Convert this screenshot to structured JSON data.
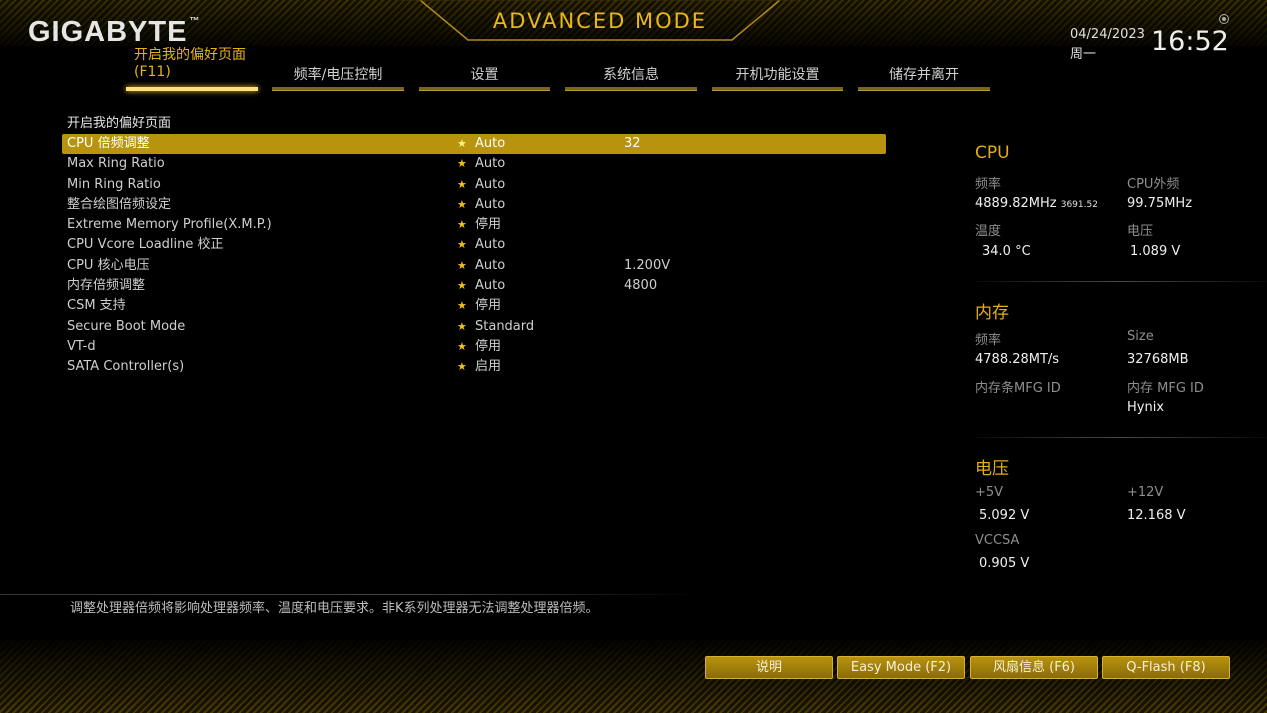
{
  "header": {
    "brand": "GIGABYTE",
    "trademark": "™",
    "mode_title": "ADVANCED MODE",
    "date": "04/24/2023",
    "weekday": "周一",
    "time": "16:52"
  },
  "tabs": [
    {
      "label": "开启我的偏好页面",
      "shortcut": "(F11)",
      "active": true
    },
    {
      "label": "频率/电压控制"
    },
    {
      "label": "设置"
    },
    {
      "label": "系统信息"
    },
    {
      "label": "开机功能设置"
    },
    {
      "label": "储存并离开"
    }
  ],
  "menu": {
    "heading": "开启我的偏好页面",
    "items": [
      {
        "name": "CPU 倍频调整",
        "value": "Auto",
        "value2": "32",
        "selected": true
      },
      {
        "name": "Max Ring Ratio",
        "value": "Auto",
        "value2": ""
      },
      {
        "name": "Min Ring Ratio",
        "value": "Auto",
        "value2": ""
      },
      {
        "name": "整合绘图倍频设定",
        "value": "Auto",
        "value2": ""
      },
      {
        "name": "Extreme Memory Profile(X.M.P.)",
        "value": "停用",
        "value2": ""
      },
      {
        "name": "CPU Vcore Loadline 校正",
        "value": "Auto",
        "value2": ""
      },
      {
        "name": "CPU 核心电压",
        "value": "Auto",
        "value2": "1.200V"
      },
      {
        "name": "内存倍频调整",
        "value": "Auto",
        "value2": "4800"
      },
      {
        "name": "CSM 支持",
        "value": "停用",
        "value2": ""
      },
      {
        "name": "Secure Boot Mode",
        "value": "Standard",
        "value2": ""
      },
      {
        "name": "VT-d",
        "value": "停用",
        "value2": ""
      },
      {
        "name": "SATA Controller(s)",
        "value": "启用",
        "value2": ""
      }
    ]
  },
  "info": {
    "cpu": {
      "title": "CPU",
      "freq_label": "频率",
      "freq_value": "4889.82MHz",
      "freq_sub": "3691.52",
      "bclk_label": "CPU外频",
      "bclk_value": "99.75MHz",
      "temp_label": "温度",
      "temp_value": "34.0 °C",
      "volt_label": "电压",
      "volt_value": "1.089 V"
    },
    "memory": {
      "title": "内存",
      "freq_label": "频率",
      "freq_value": "4788.28MT/s",
      "size_label": "Size",
      "size_value": "32768MB",
      "stick_mfg_label": "内存条MFG ID",
      "mfg_label": "内存 MFG ID",
      "mfg_value": "Hynix"
    },
    "voltage": {
      "title": "电压",
      "v5_label": "+5V",
      "v5_value": "5.092 V",
      "v12_label": "+12V",
      "v12_value": "12.168 V",
      "vccsa_label": "VCCSA",
      "vccsa_value": "0.905 V"
    }
  },
  "description": "调整处理器倍频将影响处理器频率、温度和电压要求。非K系列处理器无法调整处理器倍频。",
  "footer_buttons": [
    {
      "label": "说明"
    },
    {
      "label": "Easy Mode (F2)"
    },
    {
      "label": "风扇信息 (F6)"
    },
    {
      "label": "Q-Flash (F8)"
    }
  ],
  "colors": {
    "accent": "#e4ad1a",
    "selection": "#b8940e",
    "star": "#f2c21a"
  }
}
